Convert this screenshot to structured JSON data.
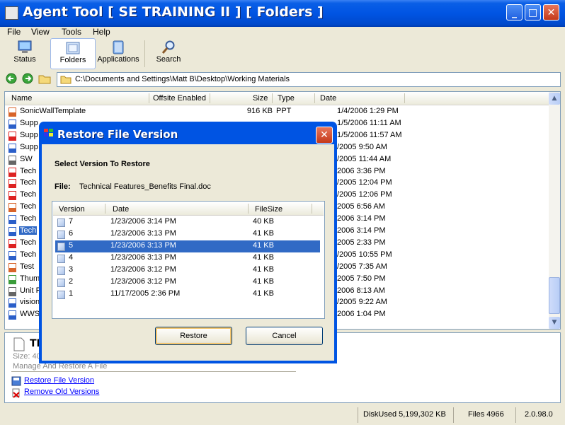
{
  "window": {
    "title": "Agent Tool [ SE TRAINING II ]  [ Folders ]"
  },
  "menu": [
    "File",
    "View",
    "Tools",
    "Help"
  ],
  "toolbar": {
    "status": "Status",
    "folders": "Folders",
    "applications": "Applications",
    "search": "Search"
  },
  "address": {
    "path": "C:\\Documents and Settings\\Matt B\\Desktop\\Working Materials"
  },
  "filelist": {
    "columns": {
      "name": "Name",
      "offsite": "Offsite Enabled",
      "size": "Size",
      "type": "Type",
      "date": "Date"
    },
    "rows": [
      {
        "name": "SonicWallTemplate",
        "size": "916 KB",
        "type": "PPT",
        "date": "1/4/2006 1:29 PM",
        "icon": "ppt"
      },
      {
        "name": "Supp",
        "size": "",
        "type": "",
        "date": "1/5/2006 11:11 AM",
        "icon": "doc"
      },
      {
        "name": "Supp",
        "size": "",
        "type": "",
        "date": "1/5/2006 11:57 AM",
        "icon": "pdf"
      },
      {
        "name": "Supp",
        "size": "",
        "type": "",
        "date": "/2005 9:50 AM",
        "icon": "doc"
      },
      {
        "name": "SW",
        "size": "",
        "type": "",
        "date": "/2005 11:44 AM",
        "icon": "txt"
      },
      {
        "name": "Tech",
        "size": "",
        "type": "",
        "date": "2006 3:36 PM",
        "icon": "pdf"
      },
      {
        "name": "Tech",
        "size": "",
        "type": "",
        "date": "/2005 12:04 PM",
        "icon": "pdf"
      },
      {
        "name": "Tech",
        "size": "",
        "type": "",
        "date": "/2005 12:06 PM",
        "icon": "pdf"
      },
      {
        "name": "Tech",
        "size": "",
        "type": "",
        "date": "2005 6:56 AM",
        "icon": "ppt"
      },
      {
        "name": "Tech",
        "size": "",
        "type": "",
        "date": "2006 3:14 PM",
        "icon": "doc"
      },
      {
        "name": "Tech",
        "size": "",
        "type": "",
        "date": "2006 3:14 PM",
        "icon": "doc",
        "selected": true
      },
      {
        "name": "Tech",
        "size": "",
        "type": "",
        "date": "2005 2:33 PM",
        "icon": "pdf"
      },
      {
        "name": "Tech",
        "size": "",
        "type": "",
        "date": "/2005 10:55 PM",
        "icon": "doc"
      },
      {
        "name": "Test",
        "size": "",
        "type": "",
        "date": "/2005 7:35 AM",
        "icon": "ppt"
      },
      {
        "name": "Thum",
        "size": "",
        "type": "",
        "date": "2005 7:50 PM",
        "icon": "img"
      },
      {
        "name": "Unit F",
        "size": "",
        "type": "",
        "date": "2006 8:13 AM",
        "icon": "txt"
      },
      {
        "name": "vision",
        "size": "",
        "type": "",
        "date": "/2005 9:22 AM",
        "icon": "doc"
      },
      {
        "name": "WWS",
        "size": "",
        "type": "",
        "date": "2006 1:04 PM",
        "icon": "doc"
      }
    ]
  },
  "details": {
    "title": "TE",
    "size_line": "Size: 40",
    "description": "Manage And Restore A File",
    "restore_link": "Restore File Version",
    "remove_link": "Remove Old Versions"
  },
  "statusbar": {
    "disk": "DiskUsed 5,199,302 KB",
    "files": "Files 4966",
    "version": "2.0.98.0"
  },
  "dialog": {
    "title": "Restore File Version",
    "heading": "Select Version To Restore",
    "file_label": "File:",
    "file_name": "Technical Features_Benefits Final.doc",
    "columns": {
      "version": "Version",
      "date": "Date",
      "filesize": "FileSize"
    },
    "versions": [
      {
        "version": "7",
        "date": "1/23/2006 3:14 PM",
        "size": "40 KB"
      },
      {
        "version": "6",
        "date": "1/23/2006 3:13 PM",
        "size": "41 KB"
      },
      {
        "version": "5",
        "date": "1/23/2006 3:13 PM",
        "size": "41 KB",
        "selected": true
      },
      {
        "version": "4",
        "date": "1/23/2006 3:13 PM",
        "size": "41 KB"
      },
      {
        "version": "3",
        "date": "1/23/2006 3:12 PM",
        "size": "41 KB"
      },
      {
        "version": "2",
        "date": "1/23/2006 3:12 PM",
        "size": "41 KB"
      },
      {
        "version": "1",
        "date": "11/17/2005 2:36 PM",
        "size": "41 KB"
      }
    ],
    "restore_label": "Restore",
    "cancel_label": "Cancel"
  },
  "colors": {
    "titlebar": "#0054e3",
    "selection": "#316ac5",
    "window_bg": "#ece9d8"
  }
}
